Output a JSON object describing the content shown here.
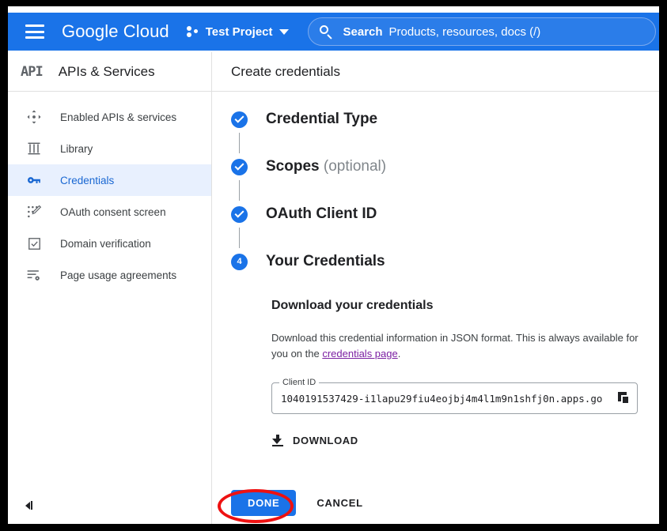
{
  "header": {
    "menu_icon": "hamburger-icon",
    "brand": "Google Cloud",
    "project_name": "Test Project",
    "project_icon": "project-dots-icon",
    "project_caret": "chevron-down-icon",
    "search": {
      "icon": "search-icon",
      "label": "Search",
      "placeholder": "Products, resources, docs (/)"
    },
    "accent_color": "#1a73e8"
  },
  "sidebar": {
    "logo_text": "API",
    "title": "APIs & Services",
    "collapse_icon": "collapse-panel-icon",
    "selected_bg": "#e8f0fe",
    "selected_text": "#1967d2",
    "items": [
      {
        "label": "Enabled APIs & services",
        "icon": "dashboard-arrows-icon",
        "selected": false
      },
      {
        "label": "Library",
        "icon": "library-columns-icon",
        "selected": false
      },
      {
        "label": "Credentials",
        "icon": "key-icon",
        "selected": true
      },
      {
        "label": "OAuth consent screen",
        "icon": "oauth-dots-icon",
        "selected": false
      },
      {
        "label": "Domain verification",
        "icon": "checkbox-icon",
        "selected": false
      },
      {
        "label": "Page usage agreements",
        "icon": "list-gear-icon",
        "selected": false
      }
    ]
  },
  "main": {
    "title": "Create credentials",
    "steps": [
      {
        "label": "Credential Type",
        "optional_suffix": "",
        "state": "complete",
        "badge": "check-icon"
      },
      {
        "label": "Scopes",
        "optional_suffix": "(optional)",
        "state": "complete",
        "badge": "check-icon"
      },
      {
        "label": "OAuth Client ID",
        "optional_suffix": "",
        "state": "complete",
        "badge": "check-icon"
      },
      {
        "label": "Your Credentials",
        "optional_suffix": "",
        "state": "current",
        "badge": "4"
      }
    ],
    "panel": {
      "title": "Download your credentials",
      "description_part1": "Download this credential information in JSON format. This is always available for you on the ",
      "description_link": "credentials page",
      "description_part2": ".",
      "link_color": "#7b1fa2",
      "client_id_label": "Client ID",
      "client_id_value": "1040191537429-i1lapu29fiu4eojbj4m4l1m9n1shfj0n.apps.go",
      "copy_icon": "copy-icon",
      "download_icon": "download-icon",
      "download_label": "DOWNLOAD"
    },
    "actions": {
      "primary_label": "DONE",
      "secondary_label": "CANCEL"
    }
  },
  "annotation": {
    "shape": "ellipse-highlight",
    "color": "#ee1111",
    "target": "DONE"
  }
}
